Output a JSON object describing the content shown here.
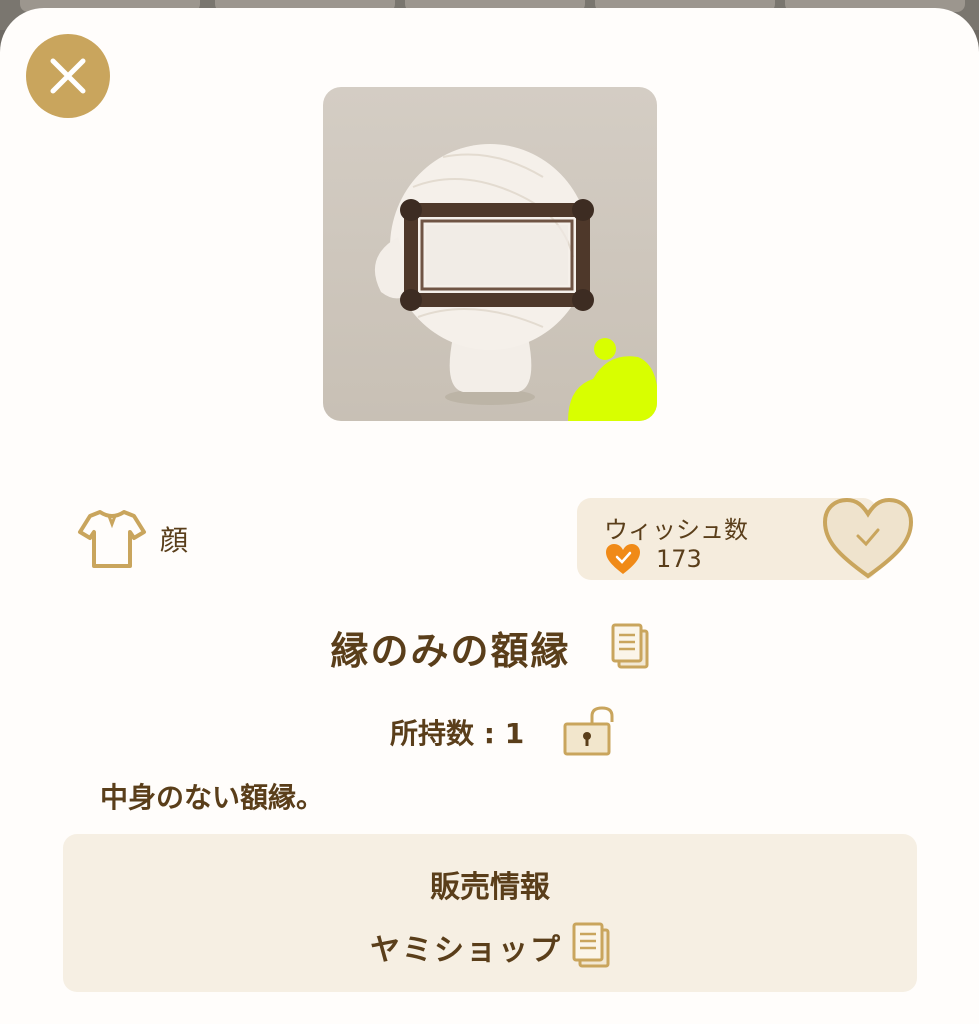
{
  "colors": {
    "accent_gold": "#c9a55d",
    "text_brown": "#5a3e1a",
    "wish_orange": "#f08a17",
    "panel_bg": "#f6efe3",
    "badge_lime": "#d8ff00"
  },
  "header": {
    "close_icon": "close-x-icon"
  },
  "item": {
    "category_icon": "shirt-icon",
    "category_label": "顔",
    "name": "縁のみの額縁",
    "owned_label": "所持数 : 1",
    "lock_icon": "unlocked-padlock-icon",
    "description": "中身のない額縁。"
  },
  "wishlist": {
    "title": "ウィッシュ数",
    "count": "173",
    "button_icon": "heart-check-icon"
  },
  "sales": {
    "title": "販売情報",
    "shop_name": "ヤミショップ"
  }
}
